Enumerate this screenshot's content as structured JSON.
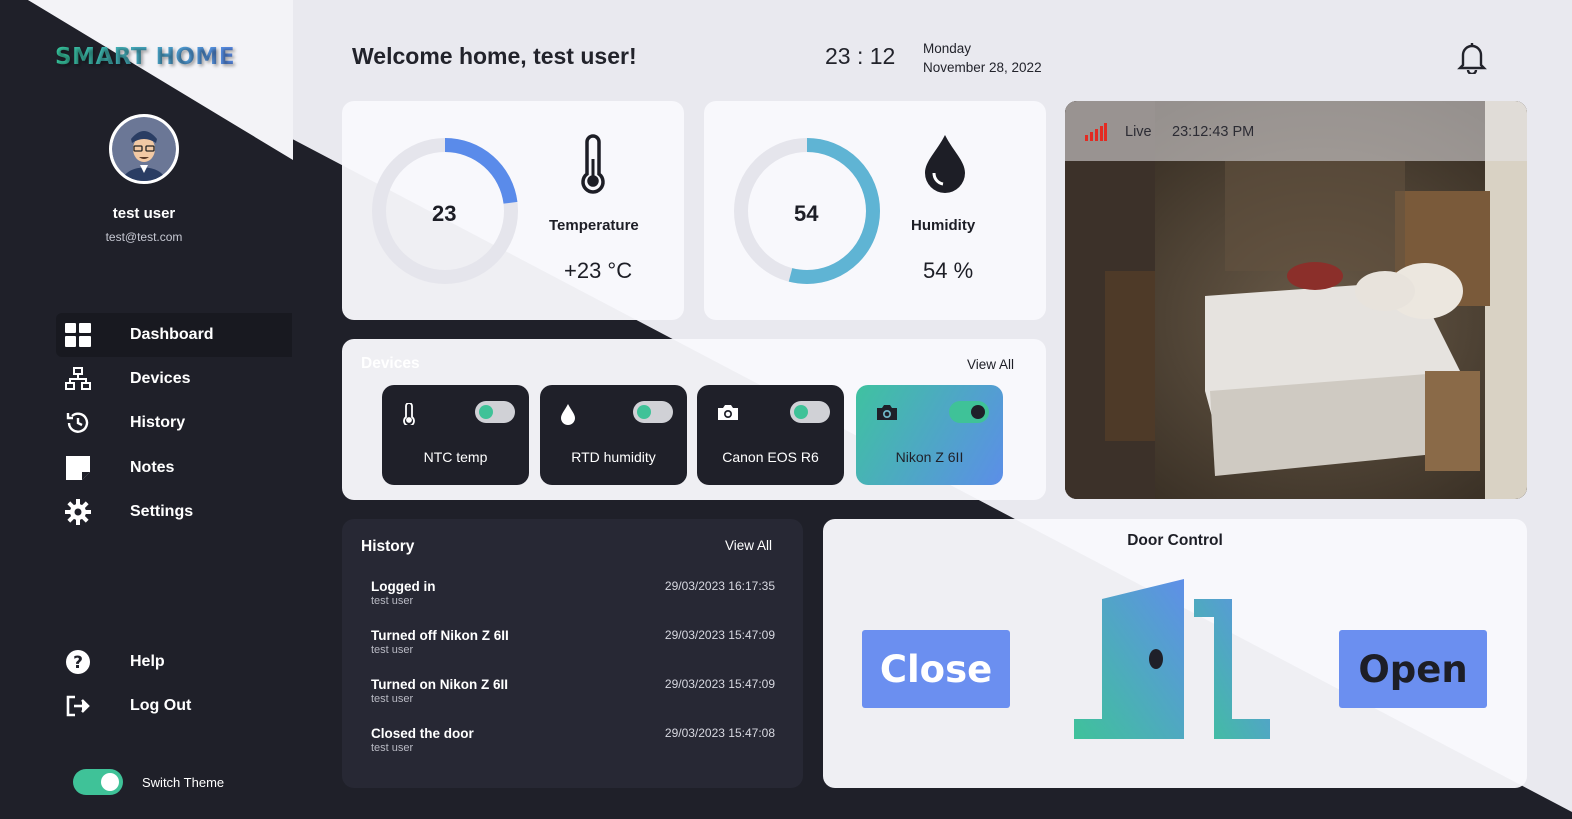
{
  "app": {
    "logo": "SMART HOME"
  },
  "user": {
    "name": "test user",
    "email": "test@test.com"
  },
  "nav": {
    "items": [
      {
        "label": "Dashboard",
        "icon": "dashboard-grid-icon",
        "active": true
      },
      {
        "label": "Devices",
        "icon": "network-icon"
      },
      {
        "label": "History",
        "icon": "history-icon"
      },
      {
        "label": "Notes",
        "icon": "note-icon"
      },
      {
        "label": "Settings",
        "icon": "gear-icon"
      }
    ],
    "bottom": [
      {
        "label": "Help",
        "icon": "question-icon"
      },
      {
        "label": "Log Out",
        "icon": "logout-icon"
      }
    ],
    "theme_label": "Switch Theme"
  },
  "header": {
    "welcome": "Welcome home, test user!",
    "clock": "23 : 12",
    "weekday": "Monday",
    "date": "November 28, 2022"
  },
  "temperature": {
    "gauge_value": "23",
    "gauge_fraction": 0.23,
    "label": "Temperature",
    "value": "+23 °C",
    "color": "#5a8bea"
  },
  "humidity": {
    "gauge_value": "54",
    "gauge_fraction": 0.54,
    "label": "Humidity",
    "value": "54 %",
    "color": "#5fb4d4"
  },
  "camera": {
    "live": "Live",
    "time": "23:12:43 PM"
  },
  "devices": {
    "title": "Devices",
    "view_all": "View All",
    "items": [
      {
        "name": "NTC temp",
        "icon": "thermometer-icon",
        "on": false
      },
      {
        "name": "RTD humidity",
        "icon": "drop-icon",
        "on": false
      },
      {
        "name": "Canon EOS R6",
        "icon": "camera-icon",
        "on": false
      },
      {
        "name": "Nikon Z 6II",
        "icon": "camera-icon",
        "on": true
      }
    ]
  },
  "history": {
    "title": "History",
    "view_all": "View All",
    "items": [
      {
        "event": "Logged in",
        "by": "test user",
        "time": "29/03/2023 16:17:35"
      },
      {
        "event": "Turned off Nikon Z 6II",
        "by": "test user",
        "time": "29/03/2023 15:47:09"
      },
      {
        "event": "Turned on Nikon Z 6II",
        "by": "test user",
        "time": "29/03/2023 15:47:09"
      },
      {
        "event": "Closed the door",
        "by": "test user",
        "time": "29/03/2023 15:47:08"
      }
    ]
  },
  "door": {
    "title": "Door Control",
    "close_label": "Close",
    "open_label": "Open"
  }
}
